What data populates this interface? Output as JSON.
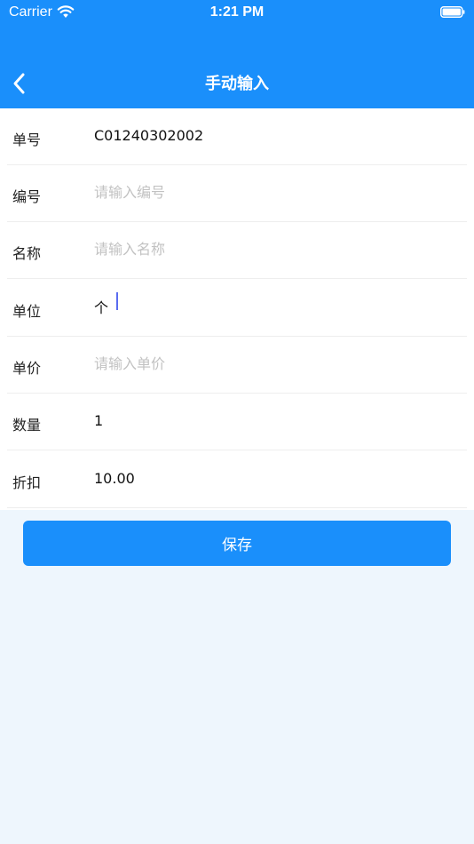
{
  "status_bar": {
    "carrier": "Carrier",
    "time": "1:21 PM",
    "wifi_icon": "wifi-icon",
    "battery_icon": "battery-full-icon"
  },
  "nav": {
    "title": "手动输入",
    "back_icon": "chevron-left-icon"
  },
  "form": {
    "rows": [
      {
        "label": "单号",
        "value": "C01240302002",
        "placeholder": ""
      },
      {
        "label": "编号",
        "value": "",
        "placeholder": "请输入编号"
      },
      {
        "label": "名称",
        "value": "",
        "placeholder": "请输入名称"
      },
      {
        "label": "单位",
        "value": "个",
        "placeholder": ""
      },
      {
        "label": "单价",
        "value": "",
        "placeholder": "请输入单价"
      },
      {
        "label": "数量",
        "value": "1",
        "placeholder": ""
      },
      {
        "label": "折扣",
        "value": "10.00",
        "placeholder": ""
      }
    ]
  },
  "actions": {
    "save_label": "保存"
  },
  "colors": {
    "primary": "#1a8ffb",
    "background": "#eef6fd",
    "placeholder": "#c2c2c2"
  }
}
